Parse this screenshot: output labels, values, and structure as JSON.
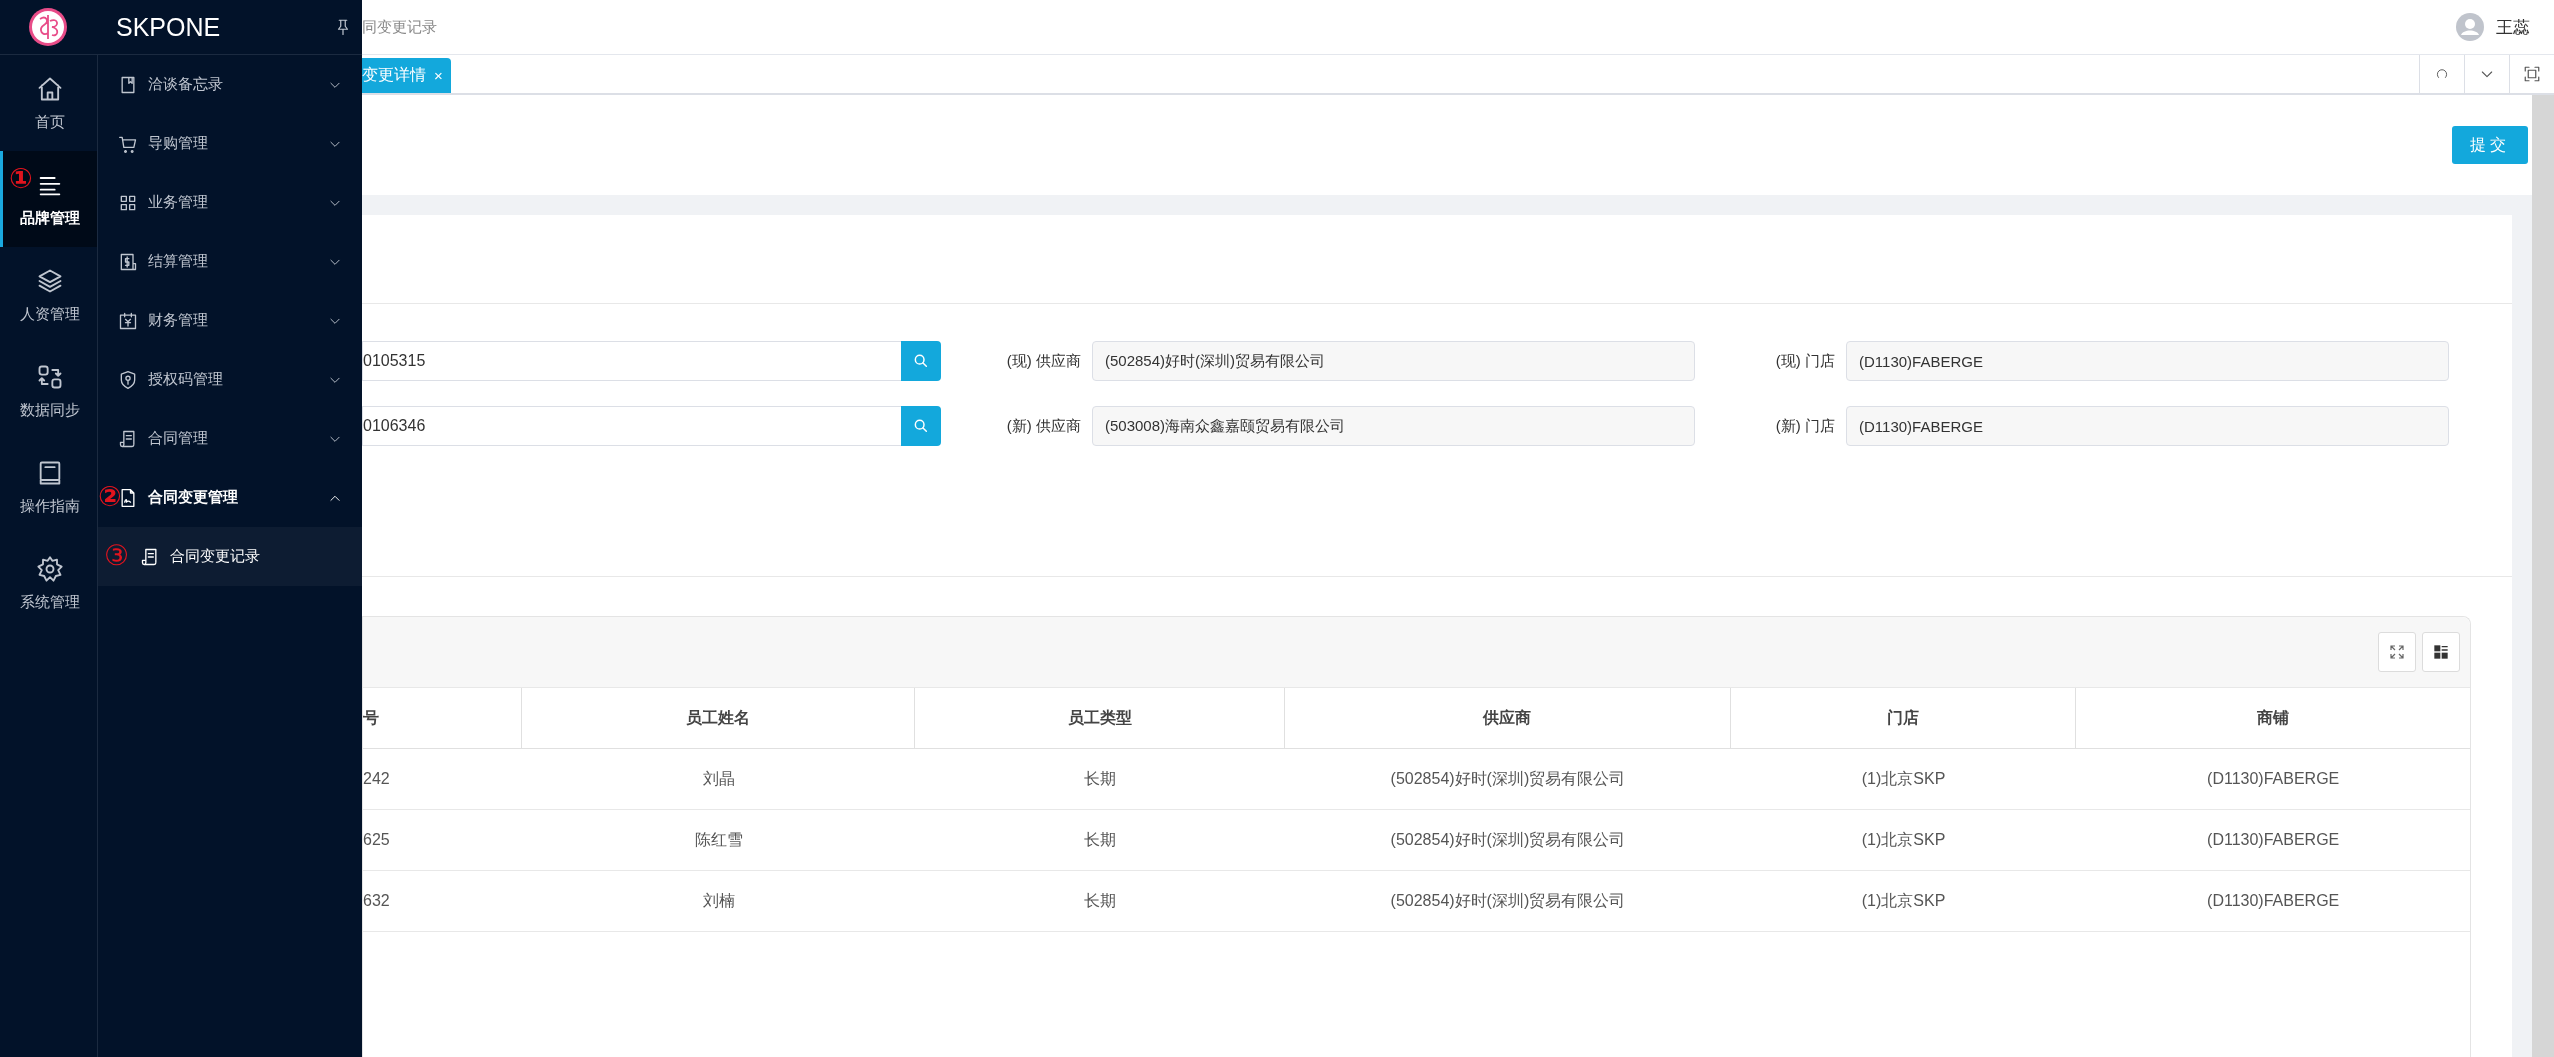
{
  "app": {
    "name": "SKPONE"
  },
  "nav": [
    {
      "label": "首页",
      "selected": false
    },
    {
      "label": "品牌管理",
      "selected": true,
      "marker": "①"
    },
    {
      "label": "人资管理",
      "selected": false
    },
    {
      "label": "数据同步",
      "selected": false
    },
    {
      "label": "操作指南",
      "selected": false
    },
    {
      "label": "系统管理",
      "selected": false
    }
  ],
  "menu": [
    {
      "label": "洽谈备忘录",
      "expanded": false
    },
    {
      "label": "导购管理",
      "expanded": false
    },
    {
      "label": "业务管理",
      "expanded": false
    },
    {
      "label": "结算管理",
      "expanded": false
    },
    {
      "label": "财务管理",
      "expanded": false
    },
    {
      "label": "授权码管理",
      "expanded": false
    },
    {
      "label": "合同管理",
      "expanded": false
    },
    {
      "label": "合同变更管理",
      "expanded": true,
      "marker": "②",
      "children": [
        {
          "label": "合同变更记录",
          "selected": true,
          "marker": "③"
        }
      ]
    }
  ],
  "breadcrumb": "同变更记录",
  "user": {
    "name": "王蕊"
  },
  "tabs": [
    {
      "label": "变更详情",
      "selected": true,
      "close": "×"
    }
  ],
  "submit": "提交",
  "form": {
    "rows": [
      {
        "code": "0105315",
        "fields": [
          {
            "label": "(现) 供应商",
            "value": "(502854)好时(深圳)贸易有限公司"
          },
          {
            "label": "(现) 门店",
            "value": "(D1130)FABERGE"
          }
        ]
      },
      {
        "code": "0106346",
        "fields": [
          {
            "label": "(新) 供应商",
            "value": "(503008)海南众鑫嘉颐贸易有限公司"
          },
          {
            "label": "(新) 门店",
            "value": "(D1130)FABERGE"
          }
        ]
      }
    ]
  },
  "table": {
    "columns": [
      "号",
      "员工姓名",
      "员工类型",
      "供应商",
      "门店",
      "商铺"
    ],
    "rows": [
      [
        "242",
        "刘晶",
        "长期",
        "(502854)好时(深圳)贸易有限公司",
        "(1)北京SKP",
        "(D1130)FABERGE"
      ],
      [
        "625",
        "陈红雪",
        "长期",
        "(502854)好时(深圳)贸易有限公司",
        "(1)北京SKP",
        "(D1130)FABERGE"
      ],
      [
        "632",
        "刘楠",
        "长期",
        "(502854)好时(深圳)贸易有限公司",
        "(1)北京SKP",
        "(D1130)FABERGE"
      ]
    ]
  }
}
